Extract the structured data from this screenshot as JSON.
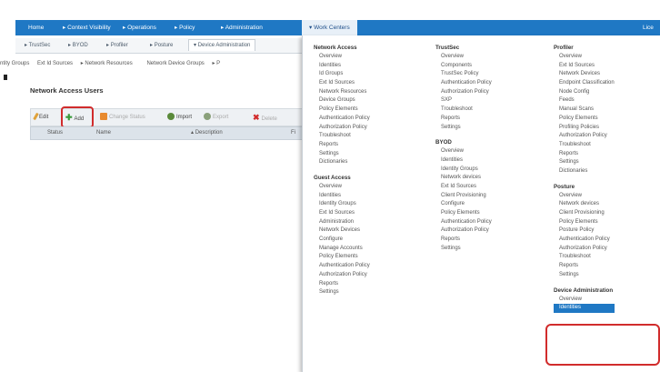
{
  "topnav": {
    "items": [
      "Home",
      "Context Visibility",
      "Operations",
      "Policy",
      "Administration",
      "Work Centers"
    ],
    "right": "Lice"
  },
  "subnav": {
    "tabs": [
      "TrustSec",
      "BYOD",
      "Profiler",
      "Posture",
      "Device Administration"
    ]
  },
  "breadcrumbs": [
    "ntity Groups",
    "Ext Id Sources",
    "Network Resources",
    "Network Device Groups",
    "P"
  ],
  "page": {
    "title": "Network Access Users"
  },
  "toolbar": {
    "edit": "Edit",
    "add": "Add",
    "change_status": "Change Status",
    "import": "Import",
    "export": "Export",
    "delete": "Delete"
  },
  "table": {
    "headers": [
      "Status",
      "Name",
      "Description",
      "Fi"
    ]
  },
  "menu": {
    "columns": [
      [
        {
          "title": "Network Access",
          "items": [
            "Overview",
            "Identities",
            "Id Groups",
            "Ext Id Sources",
            "Network Resources",
            "Device Groups",
            "Policy Elements",
            "Authentication Policy",
            "Authorization Policy",
            "Troubleshoot",
            "Reports",
            "Settings",
            "Dictionaries"
          ]
        },
        {
          "title": "Guest Access",
          "items": [
            "Overview",
            "Identities",
            "Identity Groups",
            "Ext Id Sources",
            "Administration",
            "Network Devices",
            "Configure",
            "Manage Accounts",
            "Policy Elements",
            "Authentication Policy",
            "Authorization Policy",
            "Reports",
            "Settings"
          ]
        }
      ],
      [
        {
          "title": "TrustSec",
          "items": [
            "Overview",
            "Components",
            "TrustSec Policy",
            "Authentication Policy",
            "Authorization Policy",
            "SXP",
            "Troubleshoot",
            "Reports",
            "Settings"
          ]
        },
        {
          "title": "BYOD",
          "items": [
            "Overview",
            "Identities",
            "Identity Groups",
            "Network devices",
            "Ext Id Sources",
            "Client Provisioning",
            "Configure",
            "Policy Elements",
            "Authentication Policy",
            "Authorization Policy",
            "Reports",
            "Settings"
          ]
        }
      ],
      [
        {
          "title": "Profiler",
          "items": [
            "Overview",
            "Ext Id Sources",
            "Network Devices",
            "Endpoint Classification",
            "Node Config",
            "Feeds",
            "Manual Scans",
            "Policy Elements",
            "Profiling Policies",
            "Authorization Policy",
            "Troubleshoot",
            "Reports",
            "Settings",
            "Dictionaries"
          ]
        },
        {
          "title": "Posture",
          "items": [
            "Overview",
            "Network devices",
            "Client Provisioning",
            "Policy Elements",
            "Posture Policy",
            "Authentication Policy",
            "Authorization Policy",
            "Troubleshoot",
            "Reports",
            "Settings"
          ]
        },
        {
          "title": "Device Administration",
          "items": [
            "Overview",
            "Identities"
          ]
        }
      ]
    ]
  },
  "colors": {
    "nav": "#1f78c4",
    "highlight": "#d12c2c",
    "selected": "#1f78c4"
  },
  "icons": {
    "edit": "pencil-icon",
    "add": "plus-icon",
    "change_status": "status-icon",
    "import": "import-icon",
    "export": "export-icon",
    "delete": "delete-x-icon"
  }
}
